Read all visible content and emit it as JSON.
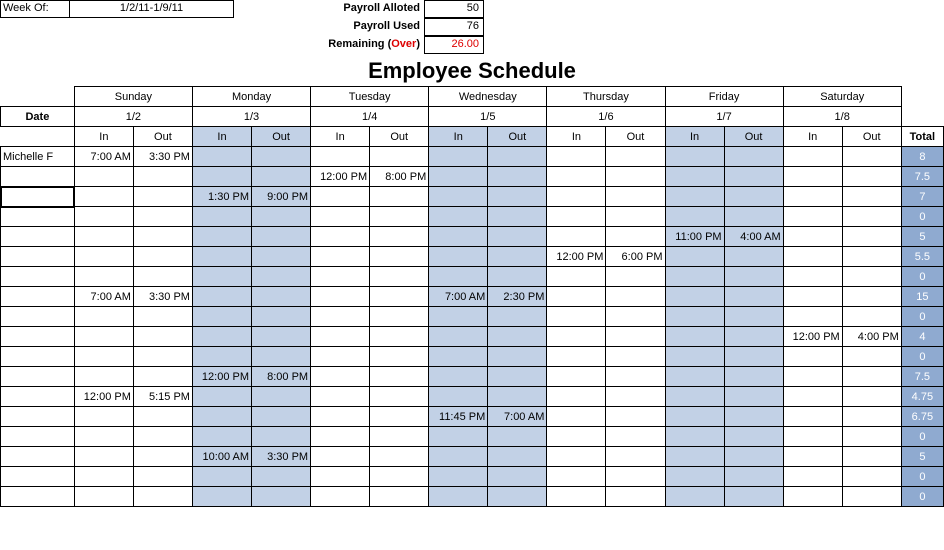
{
  "header": {
    "week_of_label": "Week Of:",
    "week_of_value": "1/2/11-1/9/11",
    "payroll_alloted_label": "Payroll Alloted",
    "payroll_alloted_value": "50",
    "payroll_used_label": "Payroll Used",
    "payroll_used_value": "76",
    "remaining_label_pre": "Remaining (",
    "remaining_label_over": "Over",
    "remaining_label_post": ")",
    "remaining_value": "26.00"
  },
  "title": "Employee Schedule",
  "labels": {
    "date": "Date",
    "in": "In",
    "out": "Out",
    "total": "Total"
  },
  "days": [
    {
      "name": "Sunday",
      "date": "1/2",
      "shade": false
    },
    {
      "name": "Monday",
      "date": "1/3",
      "shade": true
    },
    {
      "name": "Tuesday",
      "date": "1/4",
      "shade": false
    },
    {
      "name": "Wednesday",
      "date": "1/5",
      "shade": true
    },
    {
      "name": "Thursday",
      "date": "1/6",
      "shade": false
    },
    {
      "name": "Friday",
      "date": "1/7",
      "shade": true
    },
    {
      "name": "Saturday",
      "date": "1/8",
      "shade": false
    }
  ],
  "rows": [
    {
      "name": "Michelle F",
      "cells": [
        [
          "7:00 AM",
          "3:30 PM"
        ],
        [
          "",
          ""
        ],
        [
          "",
          ""
        ],
        [
          "",
          ""
        ],
        [
          "",
          ""
        ],
        [
          "",
          ""
        ],
        [
          "",
          ""
        ]
      ],
      "total": "8",
      "active": false
    },
    {
      "name": "",
      "cells": [
        [
          "",
          ""
        ],
        [
          "",
          ""
        ],
        [
          "12:00 PM",
          "8:00 PM"
        ],
        [
          "",
          ""
        ],
        [
          "",
          ""
        ],
        [
          "",
          ""
        ],
        [
          "",
          ""
        ]
      ],
      "total": "7.5",
      "active": false
    },
    {
      "name": "",
      "cells": [
        [
          "",
          ""
        ],
        [
          "1:30 PM",
          "9:00 PM"
        ],
        [
          "",
          ""
        ],
        [
          "",
          ""
        ],
        [
          "",
          ""
        ],
        [
          "",
          ""
        ],
        [
          "",
          ""
        ]
      ],
      "total": "7",
      "active": true
    },
    {
      "name": "",
      "cells": [
        [
          "",
          ""
        ],
        [
          "",
          ""
        ],
        [
          "",
          ""
        ],
        [
          "",
          ""
        ],
        [
          "",
          ""
        ],
        [
          "",
          ""
        ],
        [
          "",
          ""
        ]
      ],
      "total": "0",
      "active": false
    },
    {
      "name": "",
      "cells": [
        [
          "",
          ""
        ],
        [
          "",
          ""
        ],
        [
          "",
          ""
        ],
        [
          "",
          ""
        ],
        [
          "",
          ""
        ],
        [
          "11:00 PM",
          "4:00 AM"
        ],
        [
          "",
          ""
        ]
      ],
      "total": "5",
      "active": false
    },
    {
      "name": "",
      "cells": [
        [
          "",
          ""
        ],
        [
          "",
          ""
        ],
        [
          "",
          ""
        ],
        [
          "",
          ""
        ],
        [
          "12:00 PM",
          "6:00 PM"
        ],
        [
          "",
          ""
        ],
        [
          "",
          ""
        ]
      ],
      "total": "5.5",
      "active": false
    },
    {
      "name": "",
      "cells": [
        [
          "",
          ""
        ],
        [
          "",
          ""
        ],
        [
          "",
          ""
        ],
        [
          "",
          ""
        ],
        [
          "",
          ""
        ],
        [
          "",
          ""
        ],
        [
          "",
          ""
        ]
      ],
      "total": "0",
      "active": false
    },
    {
      "name": "",
      "cells": [
        [
          "7:00 AM",
          "3:30 PM"
        ],
        [
          "",
          ""
        ],
        [
          "",
          ""
        ],
        [
          "7:00 AM",
          "2:30 PM"
        ],
        [
          "",
          ""
        ],
        [
          "",
          ""
        ],
        [
          "",
          ""
        ]
      ],
      "total": "15",
      "active": false
    },
    {
      "name": "",
      "cells": [
        [
          "",
          ""
        ],
        [
          "",
          ""
        ],
        [
          "",
          ""
        ],
        [
          "",
          ""
        ],
        [
          "",
          ""
        ],
        [
          "",
          ""
        ],
        [
          "",
          ""
        ]
      ],
      "total": "0",
      "active": false
    },
    {
      "name": "",
      "cells": [
        [
          "",
          ""
        ],
        [
          "",
          ""
        ],
        [
          "",
          ""
        ],
        [
          "",
          ""
        ],
        [
          "",
          ""
        ],
        [
          "",
          ""
        ],
        [
          "12:00 PM",
          "4:00 PM"
        ]
      ],
      "total": "4",
      "active": false
    },
    {
      "name": "",
      "cells": [
        [
          "",
          ""
        ],
        [
          "",
          ""
        ],
        [
          "",
          ""
        ],
        [
          "",
          ""
        ],
        [
          "",
          ""
        ],
        [
          "",
          ""
        ],
        [
          "",
          ""
        ]
      ],
      "total": "0",
      "active": false
    },
    {
      "name": "",
      "cells": [
        [
          "",
          ""
        ],
        [
          "12:00 PM",
          "8:00 PM"
        ],
        [
          "",
          ""
        ],
        [
          "",
          ""
        ],
        [
          "",
          ""
        ],
        [
          "",
          ""
        ],
        [
          "",
          ""
        ]
      ],
      "total": "7.5",
      "active": false
    },
    {
      "name": "",
      "cells": [
        [
          "12:00 PM",
          "5:15 PM"
        ],
        [
          "",
          ""
        ],
        [
          "",
          ""
        ],
        [
          "",
          ""
        ],
        [
          "",
          ""
        ],
        [
          "",
          ""
        ],
        [
          "",
          ""
        ]
      ],
      "total": "4.75",
      "active": false
    },
    {
      "name": "",
      "cells": [
        [
          "",
          ""
        ],
        [
          "",
          ""
        ],
        [
          "",
          ""
        ],
        [
          "11:45 PM",
          "7:00 AM"
        ],
        [
          "",
          ""
        ],
        [
          "",
          ""
        ],
        [
          "",
          ""
        ]
      ],
      "total": "6.75",
      "active": false
    },
    {
      "name": "",
      "cells": [
        [
          "",
          ""
        ],
        [
          "",
          ""
        ],
        [
          "",
          ""
        ],
        [
          "",
          ""
        ],
        [
          "",
          ""
        ],
        [
          "",
          ""
        ],
        [
          "",
          ""
        ]
      ],
      "total": "0",
      "active": false
    },
    {
      "name": "",
      "cells": [
        [
          "",
          ""
        ],
        [
          "10:00 AM",
          "3:30 PM"
        ],
        [
          "",
          ""
        ],
        [
          "",
          ""
        ],
        [
          "",
          ""
        ],
        [
          "",
          ""
        ],
        [
          "",
          ""
        ]
      ],
      "total": "5",
      "active": false
    },
    {
      "name": "",
      "cells": [
        [
          "",
          ""
        ],
        [
          "",
          ""
        ],
        [
          "",
          ""
        ],
        [
          "",
          ""
        ],
        [
          "",
          ""
        ],
        [
          "",
          ""
        ],
        [
          "",
          ""
        ]
      ],
      "total": "0",
      "active": false
    },
    {
      "name": "",
      "cells": [
        [
          "",
          ""
        ],
        [
          "",
          ""
        ],
        [
          "",
          ""
        ],
        [
          "",
          ""
        ],
        [
          "",
          ""
        ],
        [
          "",
          ""
        ],
        [
          "",
          ""
        ]
      ],
      "total": "0",
      "active": false
    }
  ]
}
